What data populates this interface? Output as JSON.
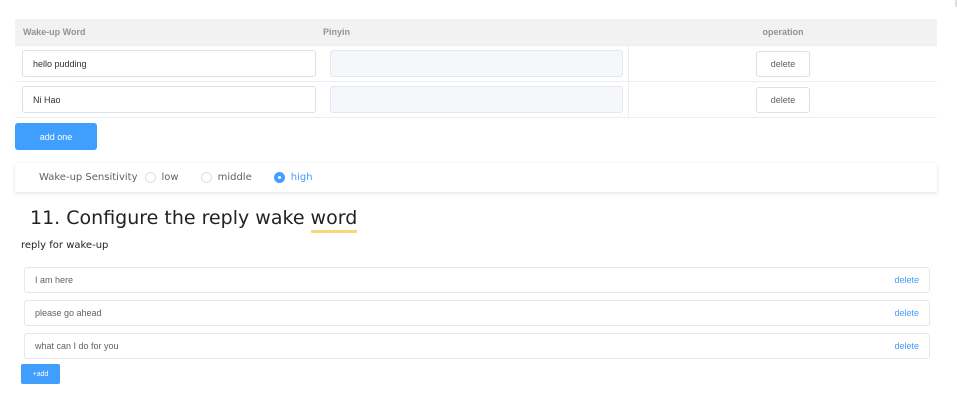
{
  "wake_table": {
    "headers": {
      "word": "Wake-up Word",
      "pinyin": "Pinyin",
      "operation": "operation"
    },
    "rows": [
      {
        "word": "hello pudding",
        "pinyin": "",
        "action": "delete"
      },
      {
        "word": "Ni Hao",
        "pinyin": "",
        "action": "delete"
      }
    ],
    "add_label": "add one"
  },
  "sensitivity": {
    "label": "Wake-up Sensitivity",
    "options": [
      "low",
      "middle",
      "high"
    ],
    "selected": "high"
  },
  "reply_section": {
    "heading_prefix": "11. Configure the reply wake ",
    "heading_highlight": "word",
    "subtitle": "reply for wake-up",
    "items": [
      {
        "text": "I am here",
        "action": "delete"
      },
      {
        "text": "please go ahead",
        "action": "delete"
      },
      {
        "text": "what can I do for you",
        "action": "delete"
      }
    ],
    "add_label": "+add"
  },
  "colors": {
    "primary": "#409eff",
    "header_bg": "#f2f2f2",
    "highlight": "#f7d774"
  }
}
